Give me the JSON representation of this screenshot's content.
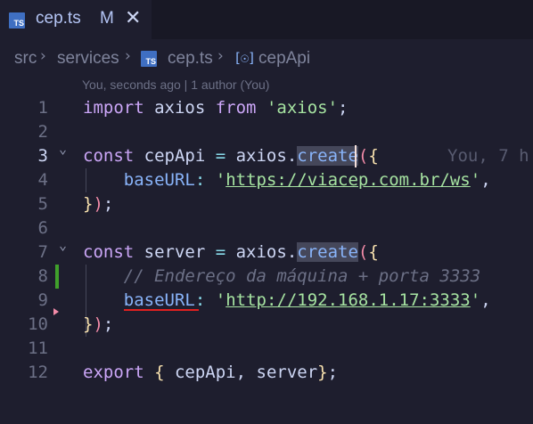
{
  "tab": {
    "file_icon": "TS",
    "title": "cep.ts",
    "status": "M",
    "close_icon": "close-icon"
  },
  "breadcrumb": {
    "items": [
      "src",
      "services",
      "cep.ts",
      "cepApi"
    ],
    "file_icon": "TS",
    "symbol_icon": "[☉]"
  },
  "codelens": "You, seconds ago | 1 author (You)",
  "inline_blame": "You, 7 h",
  "lines": [
    {
      "n": "1",
      "tokens": [
        [
          "kw",
          "import"
        ],
        [
          "ident",
          " axios "
        ],
        [
          "kw",
          "from"
        ],
        [
          "ident",
          " "
        ],
        [
          "str",
          "'axios'"
        ],
        [
          "pun",
          ";"
        ]
      ]
    },
    {
      "n": "2",
      "tokens": []
    },
    {
      "n": "3",
      "tokens": [
        [
          "kw",
          "const"
        ],
        [
          "ident",
          " cepApi "
        ],
        [
          "op",
          "="
        ],
        [
          "ident",
          " axios"
        ],
        [
          "pun",
          "."
        ],
        [
          "meth",
          "create"
        ],
        [
          "paren",
          "("
        ],
        [
          "brace",
          "{"
        ]
      ]
    },
    {
      "n": "4",
      "tokens": [
        [
          "ident",
          "    "
        ],
        [
          "prop",
          "baseURL"
        ],
        [
          "op",
          ":"
        ],
        [
          "ident",
          " "
        ],
        [
          "str",
          "'"
        ],
        [
          "str url",
          "https://viacep.com.br/ws"
        ],
        [
          "str",
          "'"
        ],
        [
          "pun",
          ","
        ]
      ]
    },
    {
      "n": "5",
      "tokens": [
        [
          "brace",
          "}"
        ],
        [
          "paren",
          ")"
        ],
        [
          "pun",
          ";"
        ]
      ]
    },
    {
      "n": "6",
      "tokens": []
    },
    {
      "n": "7",
      "tokens": [
        [
          "kw",
          "const"
        ],
        [
          "ident",
          " server "
        ],
        [
          "op",
          "="
        ],
        [
          "ident",
          " axios"
        ],
        [
          "pun",
          "."
        ],
        [
          "meth",
          "create"
        ],
        [
          "paren",
          "("
        ],
        [
          "brace",
          "{"
        ]
      ]
    },
    {
      "n": "8",
      "tokens": [
        [
          "ident",
          "    "
        ],
        [
          "comment",
          "// Endereço da máquina + porta 3333"
        ]
      ]
    },
    {
      "n": "9",
      "tokens": [
        [
          "ident",
          "    "
        ],
        [
          "prop",
          "baseURL"
        ],
        [
          "op",
          ":"
        ],
        [
          "ident",
          " "
        ],
        [
          "str",
          "'"
        ],
        [
          "str url",
          "http://192.168.1.17:3333"
        ],
        [
          "str",
          "'"
        ],
        [
          "pun",
          ","
        ]
      ]
    },
    {
      "n": "10",
      "tokens": [
        [
          "brace",
          "}"
        ],
        [
          "paren",
          ")"
        ],
        [
          "pun",
          ";"
        ]
      ]
    },
    {
      "n": "11",
      "tokens": []
    },
    {
      "n": "12",
      "tokens": [
        [
          "kw",
          "export"
        ],
        [
          "ident",
          " "
        ],
        [
          "brace",
          "{"
        ],
        [
          "ident",
          " cepApi"
        ],
        [
          "pun",
          ","
        ],
        [
          "ident",
          " server"
        ],
        [
          "brace",
          "}"
        ],
        [
          "pun",
          ";"
        ]
      ]
    }
  ],
  "active_line": "3",
  "fold_lines": [
    "3",
    "7"
  ],
  "colors": {
    "background": "#1e1e2e",
    "tab_bar": "#181825",
    "keyword": "#cba6f7",
    "string": "#a6e3a1",
    "property": "#89b4fa",
    "comment": "#6c7086",
    "error_squiggle": "#e02020",
    "git_added": "#40a02b"
  }
}
